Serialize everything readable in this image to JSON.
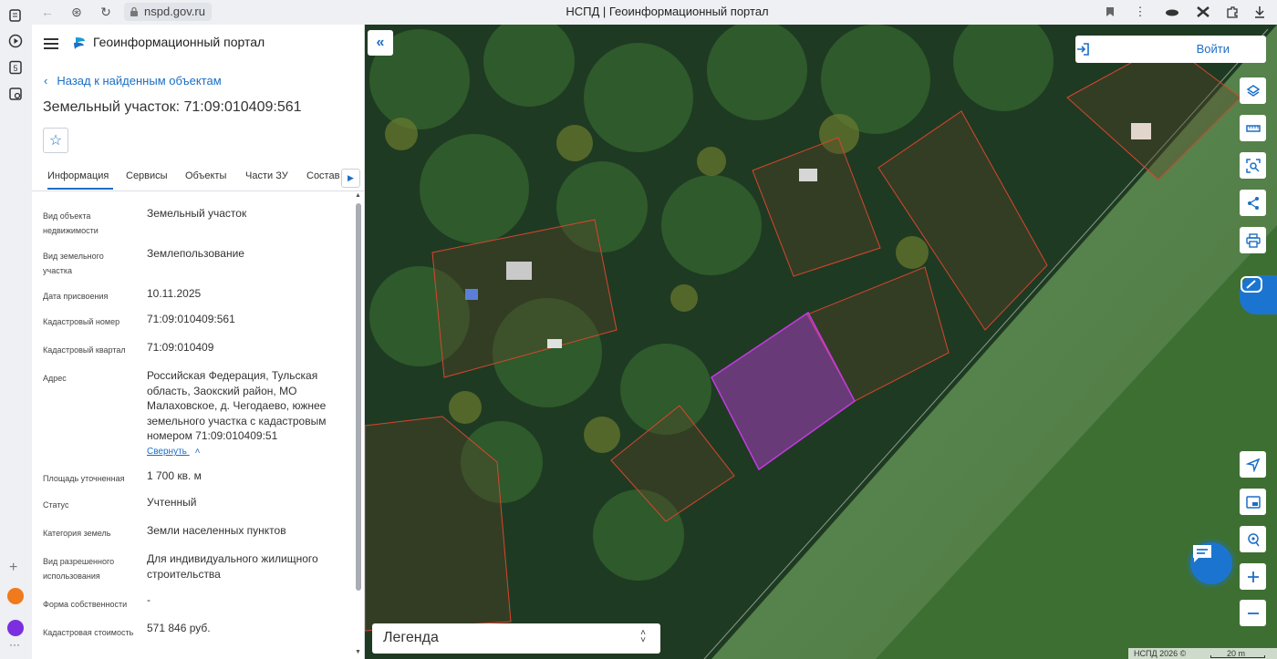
{
  "browser": {
    "url": "nspd.gov.ru",
    "page_title": "НСПД | Геоинформационный портал"
  },
  "header": {
    "portal_name": "Геоинформационный портал"
  },
  "panel": {
    "back_link": "Назад к найденным объектам",
    "object_title": "Земельный участок: 71:09:010409:561",
    "tabs": [
      "Информация",
      "Сервисы",
      "Объекты",
      "Части ЗУ",
      "Состав"
    ],
    "active_tab": "Информация",
    "collapse_link": "Свернуть",
    "attributes": [
      {
        "label": "Вид объекта недвижимости",
        "value": "Земельный участок"
      },
      {
        "label": "Вид земельного участка",
        "value": "Землепользование"
      },
      {
        "label": "Дата присвоения",
        "value": "10.11.2025"
      },
      {
        "label": "Кадастровый номер",
        "value": "71:09:010409:561"
      },
      {
        "label": "Кадастровый квартал",
        "value": "71:09:010409"
      },
      {
        "label": "Адрес",
        "value": "Российская Федерация, Тульская область, Заокский район, МО Малаховское, д. Чегодаево, южнее земельного участка с кадастровым номером 71:09:010409:51"
      },
      {
        "label": "Площадь уточненная",
        "value": "1 700 кв. м"
      },
      {
        "label": "Статус",
        "value": "Учтенный"
      },
      {
        "label": "Категория земель",
        "value": "Земли населенных пунктов"
      },
      {
        "label": "Вид разрешенного использования",
        "value": "Для индивидуального жилищного строительства"
      },
      {
        "label": "Форма собственности",
        "value": "-"
      },
      {
        "label": "Кадастровая стоимость",
        "value": "571 846 руб."
      }
    ]
  },
  "map": {
    "login_label": "Войти",
    "legend_label": "Легенда",
    "attribution": "НСПД 2026 ©",
    "scale_label": "20 m",
    "highlight_color": "#c23be0",
    "parcel_border_color": "#d9452e"
  }
}
